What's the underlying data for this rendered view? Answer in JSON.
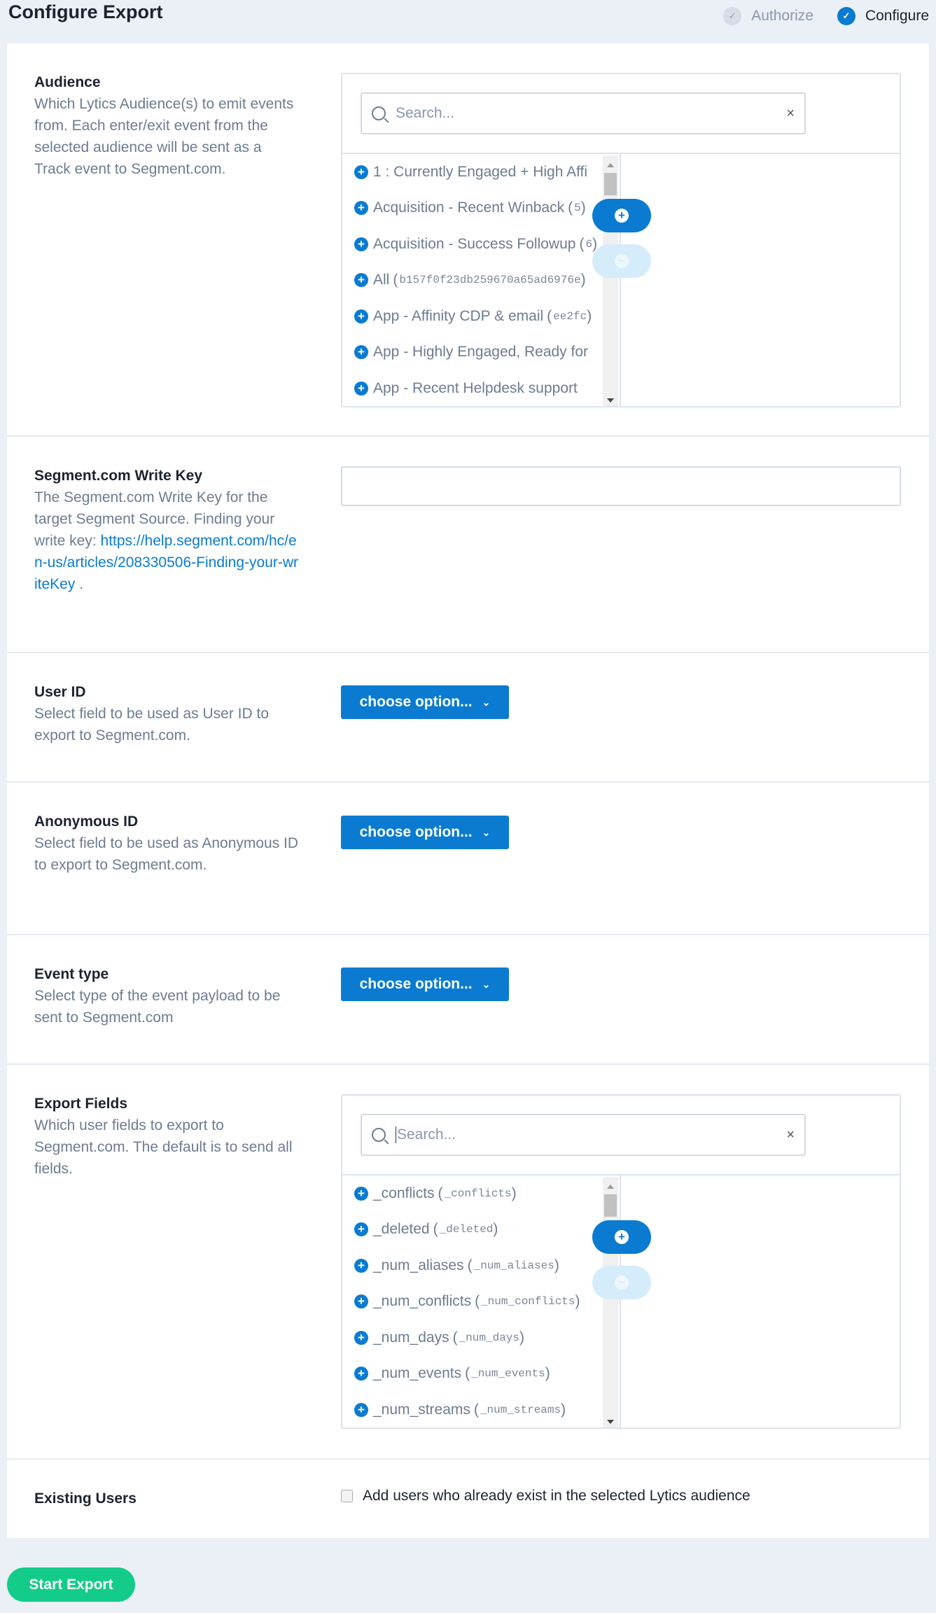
{
  "header": {
    "title": "Configure Export",
    "steps": [
      {
        "label": "Authorize",
        "state": "done"
      },
      {
        "label": "Configure",
        "state": "active"
      }
    ],
    "check_glyph": "✓"
  },
  "colors": {
    "accent": "#0a7bd1",
    "start_button": "#13cc8a"
  },
  "audience": {
    "label": "Audience",
    "description": "Which Lytics Audience(s) to emit events from. Each enter/exit event from the selected audience will be sent as a Track event to Segment.com.",
    "search_placeholder": "Search...",
    "clear": "×",
    "items": [
      {
        "name": "1 : Currently Engaged + High Affi",
        "code": ""
      },
      {
        "name": "Acquisition - Recent Winback",
        "code": "5"
      },
      {
        "name": "Acquisition - Success Followup",
        "code": "6"
      },
      {
        "name": "All",
        "code": "b157f0f23db259670a65ad6976e"
      },
      {
        "name": "App - Affinity CDP & email",
        "code": "ee2fc"
      },
      {
        "name": "App - Highly Engaged, Ready for",
        "code": ""
      },
      {
        "name": "App - Recent Helpdesk support",
        "code": ""
      }
    ]
  },
  "write_key": {
    "label": "Segment.com Write Key",
    "description": "The Segment.com Write Key for the target Segment Source. Finding your write key:",
    "link": "https://help.segment.com/hc/en-us/articles/208330506-Finding-your-writeKey",
    "after_link": " .",
    "value": ""
  },
  "user_id": {
    "label": "User ID",
    "description": "Select field to be used as User ID to export to Segment.com.",
    "button": "choose option..."
  },
  "anonymous_id": {
    "label": "Anonymous ID",
    "description": "Select field to be used as Anonymous ID to export to Segment.com.",
    "button": "choose option..."
  },
  "event_type": {
    "label": "Event type",
    "description": "Select type of the event payload to be sent to Segment.com",
    "button": "choose option..."
  },
  "export_fields": {
    "label": "Export Fields",
    "description": "Which user fields to export to Segment.com. The default is to send all fields.",
    "search_placeholder": "Search...",
    "clear": "×",
    "items": [
      {
        "name": "_conflicts",
        "code": "_conflicts"
      },
      {
        "name": "_deleted",
        "code": "_deleted"
      },
      {
        "name": "_num_aliases",
        "code": "_num_aliases"
      },
      {
        "name": "_num_conflicts",
        "code": "_num_conflicts"
      },
      {
        "name": "_num_days",
        "code": "_num_days"
      },
      {
        "name": "_num_events",
        "code": "_num_events"
      },
      {
        "name": "_num_streams",
        "code": "_num_streams"
      }
    ]
  },
  "existing_users": {
    "label": "Existing Users",
    "checkbox_label": "Add users who already exist in the selected Lytics audience",
    "checked": false
  },
  "start_button": "Start Export"
}
